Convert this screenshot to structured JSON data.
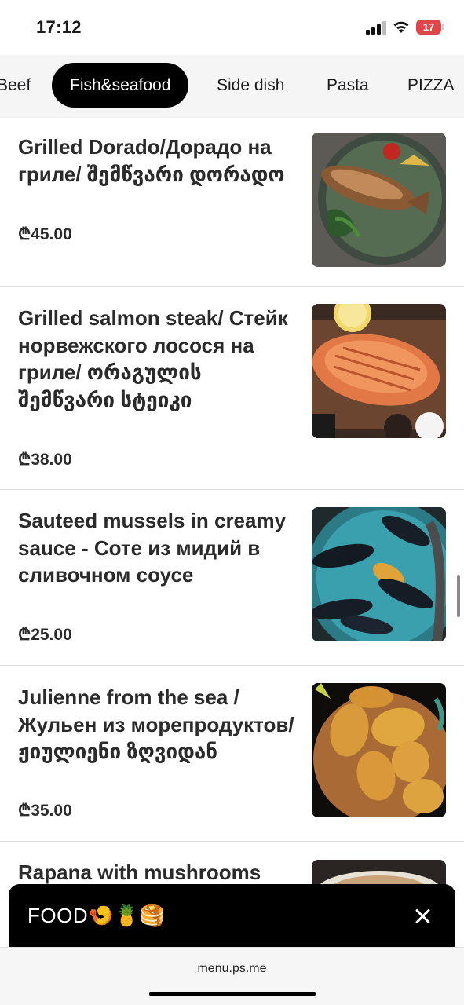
{
  "status_bar": {
    "time": "17:12",
    "battery": "17",
    "icons": [
      "signal-icon",
      "wifi-icon",
      "battery-icon"
    ]
  },
  "categories": [
    {
      "label": "Beef",
      "active": false
    },
    {
      "label": "Fish&seafood",
      "active": true
    },
    {
      "label": "Side dish",
      "active": false
    },
    {
      "label": "Pasta",
      "active": false
    },
    {
      "label": "PIZZA",
      "active": false
    }
  ],
  "menu_items": [
    {
      "name": "Grilled Dorado/Дорадо на гриле/ შემწვარი დორადო",
      "price": "₾45.00",
      "image": "grilled-dorado-photo"
    },
    {
      "name": "Grilled salmon steak/ Стейк норвежского лосося на гриле/ ორაგულის შემწვარი სტეიკი",
      "price": "₾38.00",
      "image": "salmon-steak-photo"
    },
    {
      "name": "Sauteed mussels in creamy sauce - Соте из мидий в сливочном соусе",
      "price": "₾25.00",
      "image": "mussels-photo"
    },
    {
      "name": "Julienne from the sea / Жульен из морепродуктов/ ჟიულიენი ზღვიდან",
      "price": "₾35.00",
      "image": "seafood-julienne-photo"
    },
    {
      "name": "Rapana with mushrooms",
      "price": "",
      "image": "rapana-photo"
    }
  ],
  "bottom_sheet": {
    "title": "FOOD🍤🍍🥞",
    "close_icon": "close-icon"
  },
  "browser": {
    "url": "menu.ps.me"
  },
  "colors": {
    "active_tab_bg": "#000000",
    "category_bar_bg": "#f5f5f5",
    "battery_low": "#e0454a"
  }
}
